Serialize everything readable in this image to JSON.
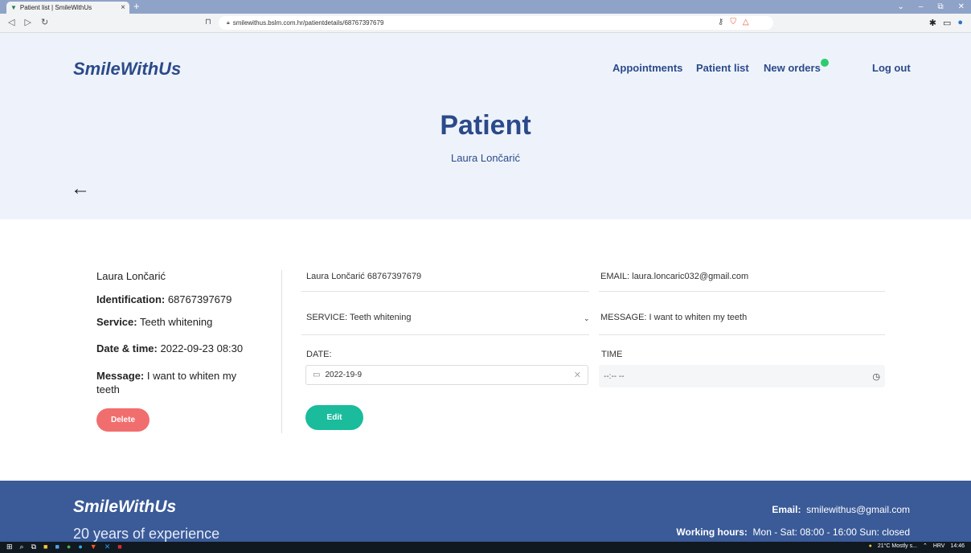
{
  "browser": {
    "tab_title": "Patient list | SmileWithUs",
    "tab_close": "×",
    "new_tab": "+",
    "url": "smilewithus.bslm.com.hr/patientdetails/68767397679",
    "win_min": "–",
    "win_max": "⧉",
    "win_close": "✕"
  },
  "header": {
    "logo": "SmileWithUs",
    "nav": {
      "appointments": "Appointments",
      "patient_list": "Patient list",
      "new_orders": "New orders",
      "logout": "Log out"
    },
    "new_orders_indicator_color": "#2ecc71"
  },
  "hero": {
    "title": "Patient",
    "subtitle": "Laura Lončarić",
    "back_icon": "←"
  },
  "details": {
    "name": "Laura Lončarić",
    "identification_label": "Identification:",
    "identification_value": "68767397679",
    "service_label": "Service:",
    "service_value": "Teeth whitening",
    "datetime_label": "Date & time:",
    "datetime_value": "2022-09-23 08:30",
    "message_label": "Message:",
    "message_value": "I want to whiten my teeth",
    "delete_label": "Delete"
  },
  "form": {
    "name_id": "Laura Lončarić  68767397679",
    "email": "EMAIL: laura.loncaric032@gmail.com",
    "service": "SERVICE:  Teeth whitening",
    "message": "MESSAGE: I want to whiten my teeth",
    "date_label": "DATE:",
    "date_value": "2022-19-9",
    "time_label": "TIME",
    "time_value": "--:-- --",
    "edit_label": "Edit"
  },
  "footer": {
    "logo": "SmileWithUs",
    "tagline": "20 years of experience",
    "email_label": "Email:",
    "email_value": "smilewithus@gmail.com",
    "hours_label": "Working hours:",
    "hours_value": "Mon - Sat: 08:00 - 16:00  Sun: closed"
  },
  "taskbar": {
    "weather": "21°C  Mostly s...",
    "language": "HRV",
    "time": "14:46"
  },
  "colors": {
    "brand_blue": "#2b4a8a",
    "hero_bg": "#eef3fb",
    "footer_bg": "#3a5a98",
    "delete_red": "#f16e6e",
    "edit_teal": "#1abc9c"
  }
}
